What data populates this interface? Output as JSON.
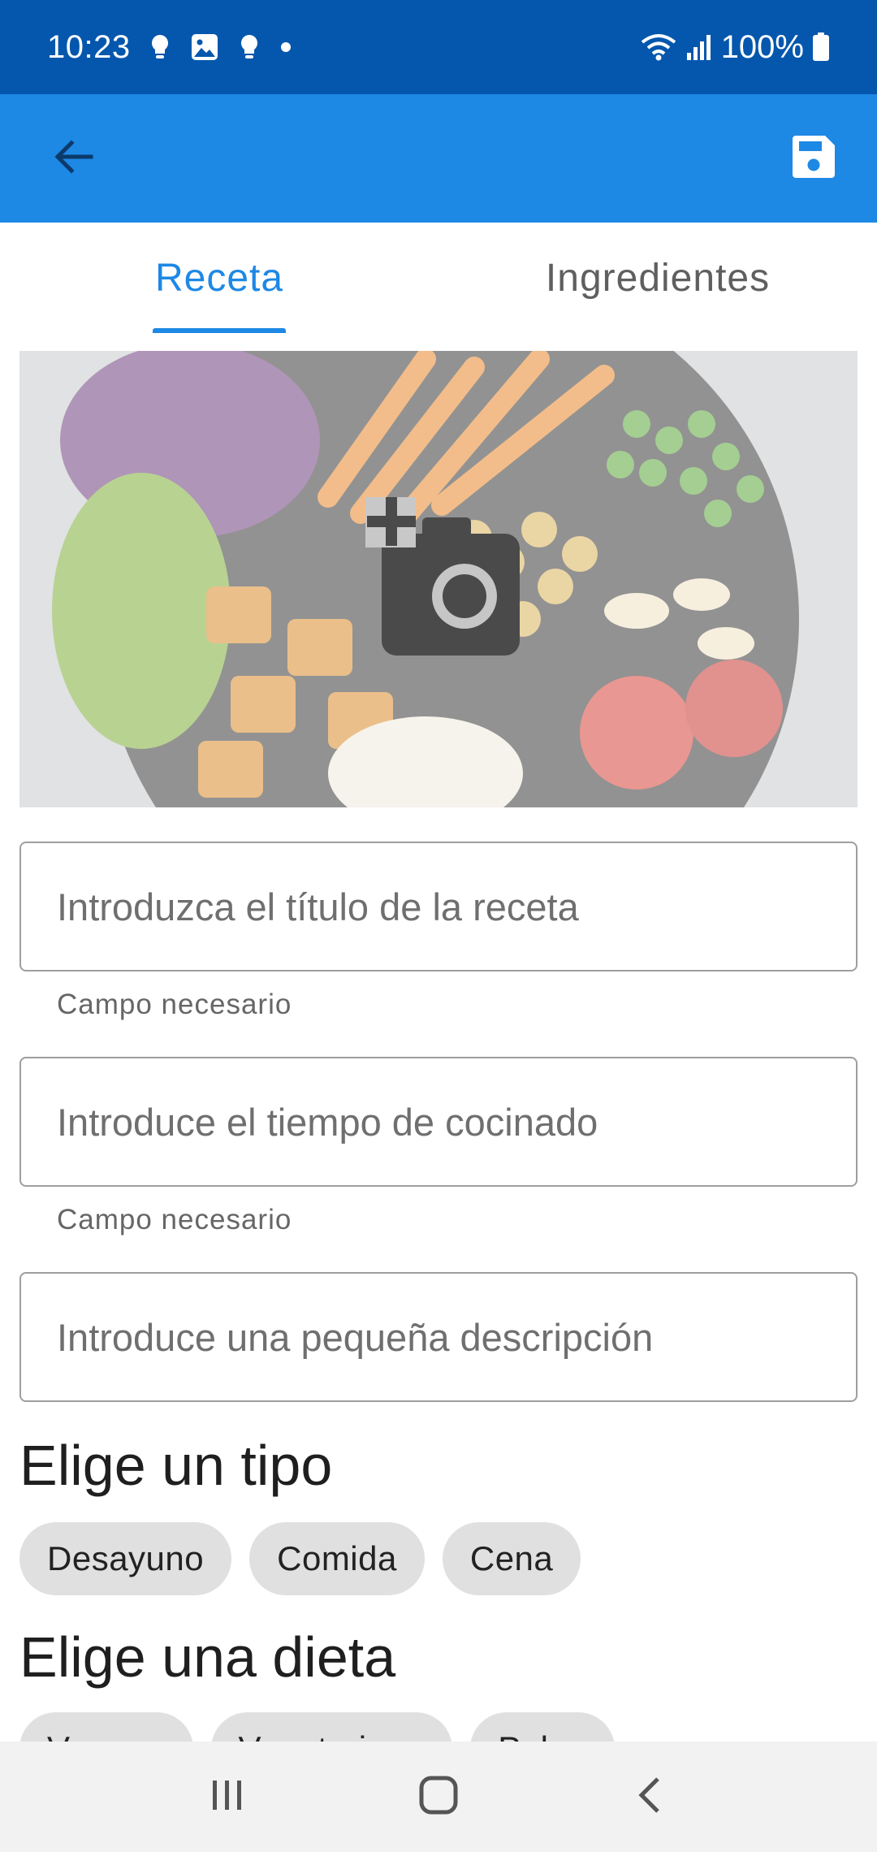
{
  "status_bar": {
    "time": "10:23",
    "battery": "100%",
    "notification_icons": [
      "bulb-icon",
      "image-icon",
      "bulb-icon",
      "dot-icon"
    ]
  },
  "app_bar": {
    "back_icon": "arrow-back-icon",
    "save_icon": "save-icon",
    "color": "#1e88e5"
  },
  "tabs": [
    {
      "label": "Receta",
      "active": true
    },
    {
      "label": "Ingredientes",
      "active": false
    }
  ],
  "image": {
    "icon": "add-photo-icon"
  },
  "fields": {
    "title": {
      "placeholder": "Introduzca el título de la receta",
      "helper": "Campo necesario"
    },
    "time": {
      "placeholder": "Introduce el tiempo de cocinado",
      "helper": "Campo necesario"
    },
    "description": {
      "placeholder": "Introduce una pequeña descripción"
    }
  },
  "type_section": {
    "title": "Elige un tipo",
    "chips": [
      "Desayuno",
      "Comida",
      "Cena"
    ]
  },
  "diet_section": {
    "title": "Elige una dieta",
    "chips": [
      "Vegana",
      "Vegetariana",
      "Paleo"
    ]
  },
  "nav_bar": {
    "icons": [
      "recents-icon",
      "home-icon",
      "back-nav-icon"
    ]
  },
  "colors": {
    "status_bar": "#0557ad",
    "accent": "#1e88e5",
    "chip": "#e0e0e0"
  }
}
